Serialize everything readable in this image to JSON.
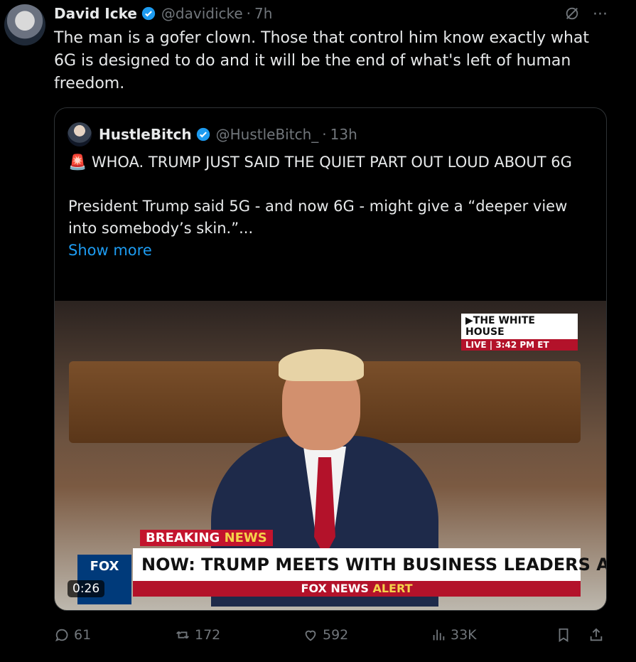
{
  "tweet": {
    "author_name": "David Icke",
    "handle": "@davidicke",
    "time": "7h",
    "text": "The man is a gofer clown. Those that control him know exactly what 6G is designed to do and it will be the end of what's left of human freedom."
  },
  "quote": {
    "author_name": "HustleBitch",
    "handle": "@HustleBitch_",
    "time": "13h",
    "line1": "🚨 WHOA.  TRUMP JUST SAID THE QUIET PART OUT LOUD ABOUT 6G",
    "line2": "President Trump said 5G - and now 6G - might give a “deeper view into somebody’s skin.”...",
    "show_more": "Show more"
  },
  "video": {
    "badge_title": "▶THE WHITE HOUSE",
    "badge_live": "LIVE  |  3:42 PM ET",
    "breaking_a": "BREAKING ",
    "breaking_b": "NEWS",
    "headline": "NOW: TRUMP MEETS WITH BUSINESS LEADERS AT WH",
    "alert_a": "FOX NEWS ",
    "alert_b": "ALERT",
    "logo_text": "FOX",
    "duration": "0:26"
  },
  "actions": {
    "replies": "61",
    "reposts": "172",
    "likes": "592",
    "views": "33K"
  },
  "icons": [
    "verified-icon",
    "grok-icon",
    "more-icon",
    "reply-icon",
    "repost-icon",
    "like-icon",
    "views-icon",
    "bookmark-icon",
    "share-icon"
  ],
  "colors": {
    "background": "#000000",
    "accent": "#1d9bf0",
    "muted": "#71767b"
  }
}
